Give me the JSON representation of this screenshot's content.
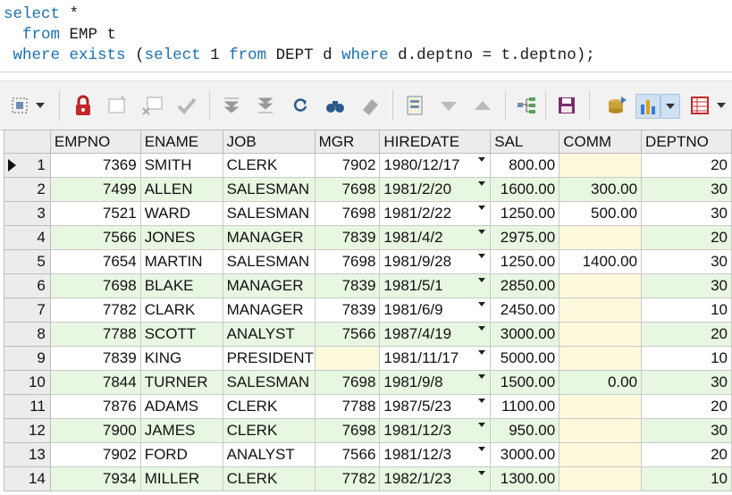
{
  "sql": {
    "line1": {
      "kw": "select",
      "rest": " *"
    },
    "line2": {
      "indent": "  ",
      "kw": "from",
      "rest": " EMP t"
    },
    "line3": {
      "indent": " ",
      "kw_where": "where",
      "kw_exists": "exists",
      "open": " (",
      "kw_select": "select",
      "one": " 1 ",
      "kw_from": "from",
      "dept": " DEPT d ",
      "kw_where2": "where",
      "tail": " d.deptno = t.deptno);"
    }
  },
  "toolbar": {
    "icons": [
      "grid-select-icon",
      "lock-icon",
      "new-record-icon",
      "delete-record-icon",
      "post-icon",
      "move-first-icon",
      "move-last-icon",
      "refresh-icon",
      "find-icon",
      "clear-icon",
      "form-view-icon",
      "sort-desc-icon",
      "sort-asc-icon",
      "tree-icon",
      "save-icon",
      "export-icon",
      "chart-icon",
      "table-options-icon"
    ]
  },
  "grid": {
    "columns": [
      "EMPNO",
      "ENAME",
      "JOB",
      "MGR",
      "HIREDATE",
      "SAL",
      "COMM",
      "DEPTNO"
    ],
    "current_row": 1,
    "rows": [
      {
        "n": "1",
        "empno": "7369",
        "ename": "SMITH",
        "job": "CLERK",
        "mgr": "7902",
        "hiredate": "1980/12/17",
        "sal": "800.00",
        "comm": "",
        "deptno": "20"
      },
      {
        "n": "2",
        "empno": "7499",
        "ename": "ALLEN",
        "job": "SALESMAN",
        "mgr": "7698",
        "hiredate": "1981/2/20",
        "sal": "1600.00",
        "comm": "300.00",
        "deptno": "30"
      },
      {
        "n": "3",
        "empno": "7521",
        "ename": "WARD",
        "job": "SALESMAN",
        "mgr": "7698",
        "hiredate": "1981/2/22",
        "sal": "1250.00",
        "comm": "500.00",
        "deptno": "30"
      },
      {
        "n": "4",
        "empno": "7566",
        "ename": "JONES",
        "job": "MANAGER",
        "mgr": "7839",
        "hiredate": "1981/4/2",
        "sal": "2975.00",
        "comm": "",
        "deptno": "20"
      },
      {
        "n": "5",
        "empno": "7654",
        "ename": "MARTIN",
        "job": "SALESMAN",
        "mgr": "7698",
        "hiredate": "1981/9/28",
        "sal": "1250.00",
        "comm": "1400.00",
        "deptno": "30"
      },
      {
        "n": "6",
        "empno": "7698",
        "ename": "BLAKE",
        "job": "MANAGER",
        "mgr": "7839",
        "hiredate": "1981/5/1",
        "sal": "2850.00",
        "comm": "",
        "deptno": "30"
      },
      {
        "n": "7",
        "empno": "7782",
        "ename": "CLARK",
        "job": "MANAGER",
        "mgr": "7839",
        "hiredate": "1981/6/9",
        "sal": "2450.00",
        "comm": "",
        "deptno": "10"
      },
      {
        "n": "8",
        "empno": "7788",
        "ename": "SCOTT",
        "job": "ANALYST",
        "mgr": "7566",
        "hiredate": "1987/4/19",
        "sal": "3000.00",
        "comm": "",
        "deptno": "20"
      },
      {
        "n": "9",
        "empno": "7839",
        "ename": "KING",
        "job": "PRESIDENT",
        "mgr": "",
        "hiredate": "1981/11/17",
        "sal": "5000.00",
        "comm": "",
        "deptno": "10"
      },
      {
        "n": "10",
        "empno": "7844",
        "ename": "TURNER",
        "job": "SALESMAN",
        "mgr": "7698",
        "hiredate": "1981/9/8",
        "sal": "1500.00",
        "comm": "0.00",
        "deptno": "30"
      },
      {
        "n": "11",
        "empno": "7876",
        "ename": "ADAMS",
        "job": "CLERK",
        "mgr": "7788",
        "hiredate": "1987/5/23",
        "sal": "1100.00",
        "comm": "",
        "deptno": "20"
      },
      {
        "n": "12",
        "empno": "7900",
        "ename": "JAMES",
        "job": "CLERK",
        "mgr": "7698",
        "hiredate": "1981/12/3",
        "sal": "950.00",
        "comm": "",
        "deptno": "30"
      },
      {
        "n": "13",
        "empno": "7902",
        "ename": "FORD",
        "job": "ANALYST",
        "mgr": "7566",
        "hiredate": "1981/12/3",
        "sal": "3000.00",
        "comm": "",
        "deptno": "20"
      },
      {
        "n": "14",
        "empno": "7934",
        "ename": "MILLER",
        "job": "CLERK",
        "mgr": "7782",
        "hiredate": "1982/1/23",
        "sal": "1300.00",
        "comm": "",
        "deptno": "10"
      }
    ]
  },
  "colors": {
    "keyword": "#1b6fb2",
    "even_row": "#e8f7e1",
    "empty_cell": "#fdf9dc",
    "header": "#ececec"
  }
}
